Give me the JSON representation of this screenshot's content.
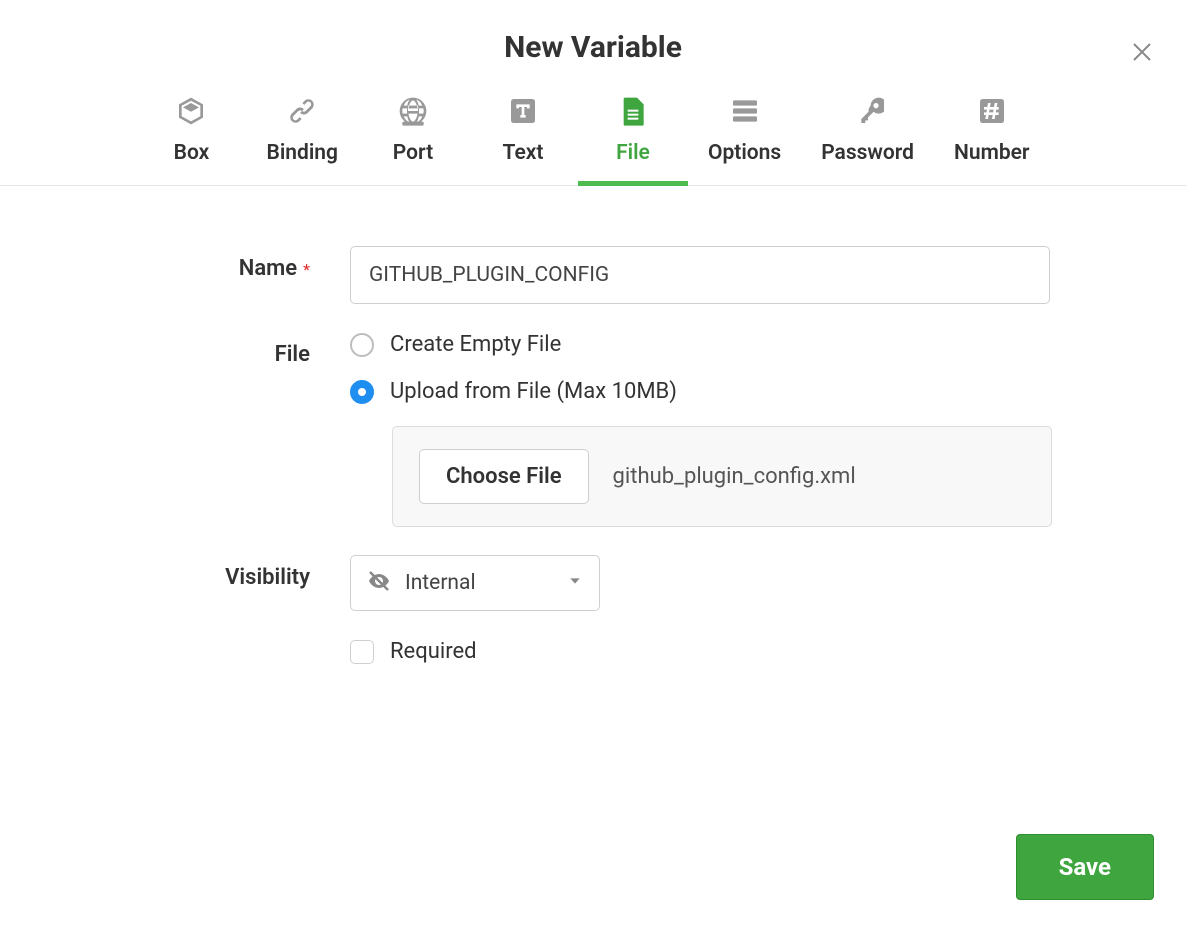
{
  "header": {
    "title": "New Variable"
  },
  "tabs": [
    {
      "label": "Box"
    },
    {
      "label": "Binding"
    },
    {
      "label": "Port"
    },
    {
      "label": "Text"
    },
    {
      "label": "File"
    },
    {
      "label": "Options"
    },
    {
      "label": "Password"
    },
    {
      "label": "Number"
    }
  ],
  "form": {
    "name_label": "Name",
    "name_value": "GITHUB_PLUGIN_CONFIG",
    "file_label": "File",
    "file_option_empty": "Create Empty File",
    "file_option_upload": "Upload from File (Max 10MB)",
    "choose_file_label": "Choose File",
    "uploaded_file_name": "github_plugin_config.xml",
    "visibility_label": "Visibility",
    "visibility_value": "Internal",
    "required_label": "Required"
  },
  "footer": {
    "save_label": "Save"
  }
}
